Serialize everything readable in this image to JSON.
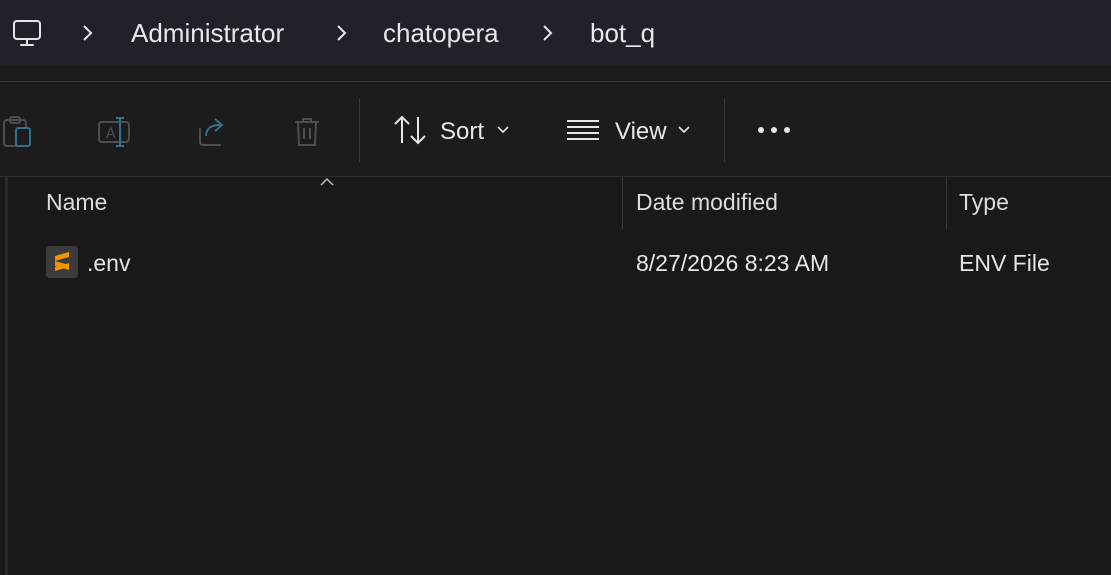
{
  "breadcrumb": {
    "items": [
      "Administrator",
      "chatopera",
      "bot_q"
    ]
  },
  "toolbar": {
    "sort_label": "Sort",
    "view_label": "View",
    "icons": [
      "paste-icon",
      "rename-icon",
      "share-icon",
      "delete-icon",
      "sort-icon",
      "view-icon",
      "more-icon"
    ]
  },
  "file_list": {
    "columns": [
      "Name",
      "Date modified",
      "Type"
    ],
    "rows": [
      {
        "name": ".env",
        "date_modified": "8/27/2026 8:23 AM",
        "type": "ENV File"
      }
    ]
  },
  "colors": {
    "background": "#191919",
    "address_bar": "#1f2329",
    "text": "#e6e6e6",
    "file_icon_accent": "#f29400"
  }
}
